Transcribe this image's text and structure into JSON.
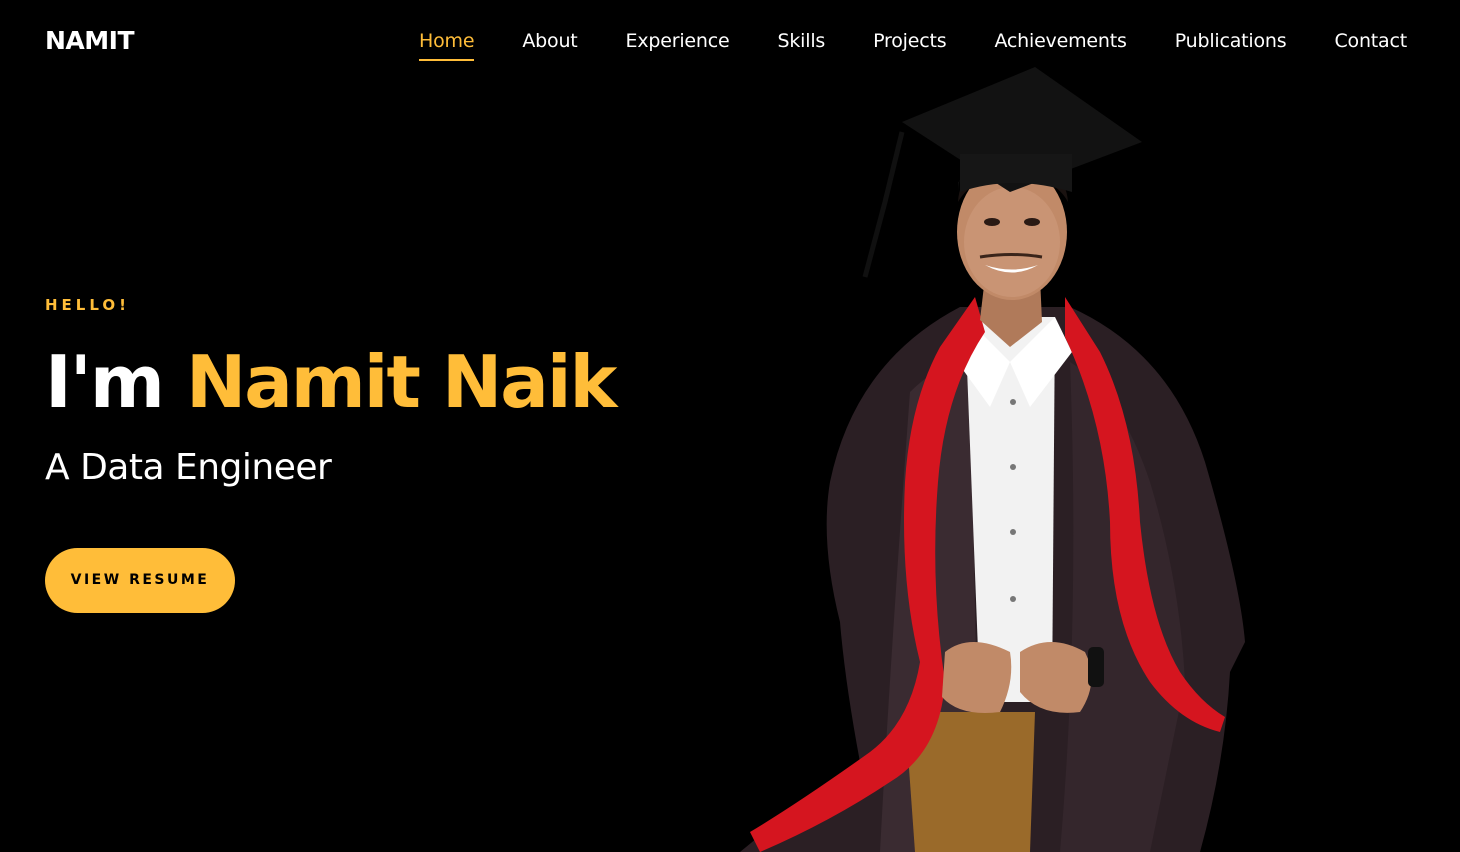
{
  "brand": {
    "name": "NAMIT"
  },
  "nav": {
    "items": [
      {
        "label": "Home",
        "active": true
      },
      {
        "label": "About",
        "active": false
      },
      {
        "label": "Experience",
        "active": false
      },
      {
        "label": "Skills",
        "active": false
      },
      {
        "label": "Projects",
        "active": false
      },
      {
        "label": "Achievements",
        "active": false
      },
      {
        "label": "Publications",
        "active": false
      },
      {
        "label": "Contact",
        "active": false
      }
    ]
  },
  "hero": {
    "greeting": "HELLO!",
    "intro": "I'm",
    "name": "Namit Naik",
    "subtitle": "A Data Engineer",
    "cta_label": "VIEW RESUME"
  },
  "colors": {
    "background": "#000000",
    "accent": "#ffbd39",
    "text": "#ffffff"
  }
}
